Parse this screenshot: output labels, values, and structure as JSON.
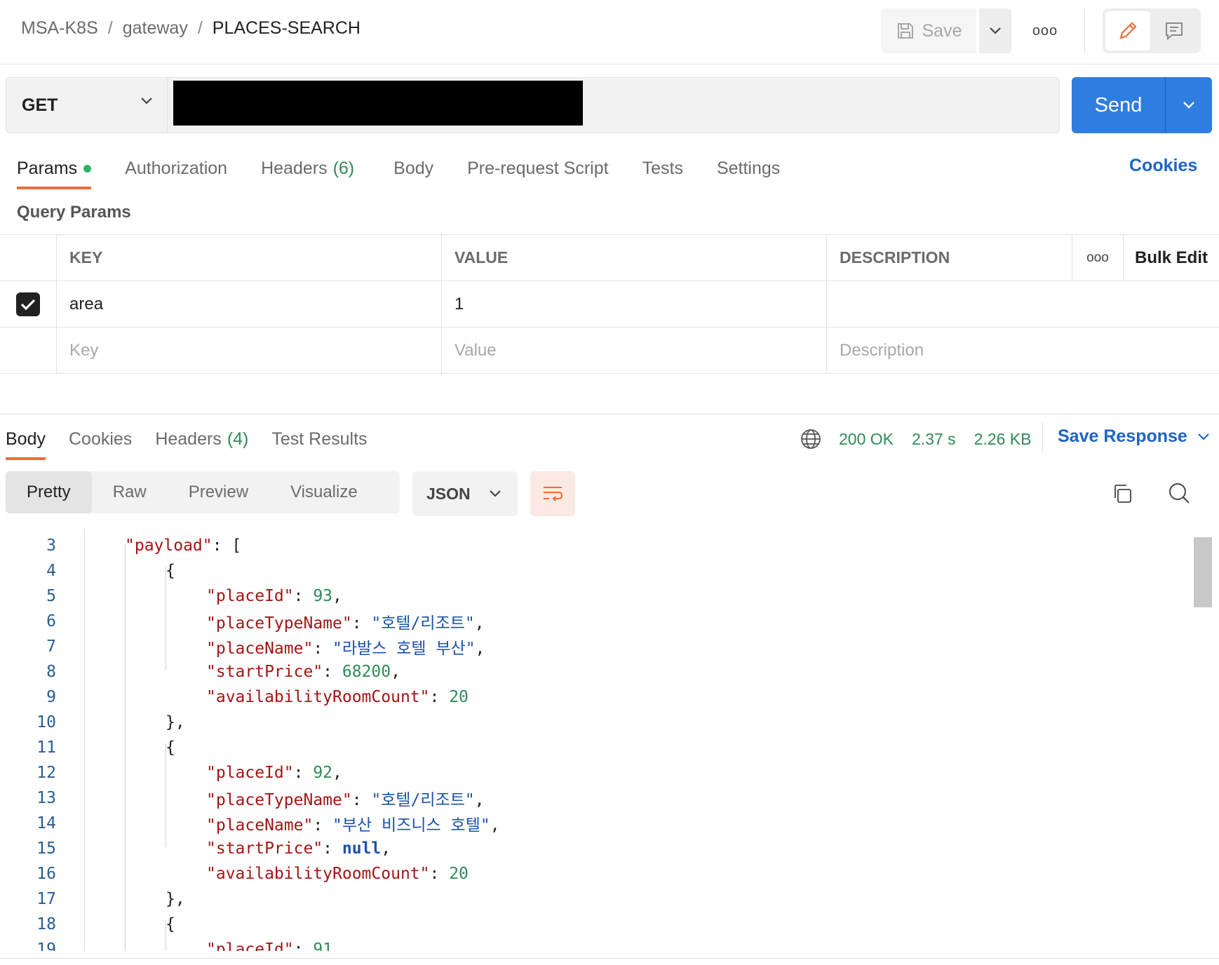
{
  "breadcrumb": {
    "collection": "MSA-K8S",
    "folder": "gateway",
    "request": "PLACES-SEARCH",
    "separator": "/"
  },
  "toolbar": {
    "save_label": "Save",
    "more_label": "ooo"
  },
  "request": {
    "method": "GET",
    "send_label": "Send"
  },
  "request_tabs": {
    "params": "Params",
    "authorization": "Authorization",
    "headers": "Headers",
    "headers_count": "(6)",
    "body": "Body",
    "prerequest": "Pre-request Script",
    "tests": "Tests",
    "settings": "Settings",
    "cookies": "Cookies"
  },
  "query_params": {
    "title": "Query Params",
    "headers": {
      "key": "KEY",
      "value": "VALUE",
      "description": "DESCRIPTION",
      "more": "ooo",
      "bulk_edit": "Bulk Edit"
    },
    "rows": [
      {
        "checked": true,
        "key": "area",
        "value": "1",
        "description": ""
      }
    ],
    "placeholders": {
      "key": "Key",
      "value": "Value",
      "description": "Description"
    }
  },
  "response_tabs": {
    "body": "Body",
    "cookies": "Cookies",
    "headers": "Headers",
    "headers_count": "(4)",
    "test_results": "Test Results"
  },
  "response_meta": {
    "status": "200 OK",
    "time": "2.37 s",
    "size": "2.26 KB",
    "save_response": "Save Response"
  },
  "format": {
    "modes": [
      "Pretty",
      "Raw",
      "Preview",
      "Visualize"
    ],
    "active": "Pretty",
    "language": "JSON"
  },
  "code_lines": [
    {
      "n": "3",
      "indent": 1,
      "tokens": [
        {
          "t": "k",
          "v": "\"payload\""
        },
        {
          "t": "p",
          "v": ": ["
        }
      ]
    },
    {
      "n": "4",
      "indent": 2,
      "tokens": [
        {
          "t": "p",
          "v": "{"
        }
      ]
    },
    {
      "n": "5",
      "indent": 3,
      "tokens": [
        {
          "t": "k",
          "v": "\"placeId\""
        },
        {
          "t": "p",
          "v": ": "
        },
        {
          "t": "n",
          "v": "93"
        },
        {
          "t": "p",
          "v": ","
        }
      ]
    },
    {
      "n": "6",
      "indent": 3,
      "tokens": [
        {
          "t": "k",
          "v": "\"placeTypeName\""
        },
        {
          "t": "p",
          "v": ": "
        },
        {
          "t": "s",
          "v": "\"호텔/리조트\""
        },
        {
          "t": "p",
          "v": ","
        }
      ]
    },
    {
      "n": "7",
      "indent": 3,
      "tokens": [
        {
          "t": "k",
          "v": "\"placeName\""
        },
        {
          "t": "p",
          "v": ": "
        },
        {
          "t": "s",
          "v": "\"라발스 호텔 부산\""
        },
        {
          "t": "p",
          "v": ","
        }
      ]
    },
    {
      "n": "8",
      "indent": 3,
      "tokens": [
        {
          "t": "k",
          "v": "\"startPrice\""
        },
        {
          "t": "p",
          "v": ": "
        },
        {
          "t": "n",
          "v": "68200"
        },
        {
          "t": "p",
          "v": ","
        }
      ]
    },
    {
      "n": "9",
      "indent": 3,
      "tokens": [
        {
          "t": "k",
          "v": "\"availabilityRoomCount\""
        },
        {
          "t": "p",
          "v": ": "
        },
        {
          "t": "n",
          "v": "20"
        }
      ]
    },
    {
      "n": "10",
      "indent": 2,
      "tokens": [
        {
          "t": "p",
          "v": "},"
        }
      ]
    },
    {
      "n": "11",
      "indent": 2,
      "tokens": [
        {
          "t": "p",
          "v": "{"
        }
      ]
    },
    {
      "n": "12",
      "indent": 3,
      "tokens": [
        {
          "t": "k",
          "v": "\"placeId\""
        },
        {
          "t": "p",
          "v": ": "
        },
        {
          "t": "n",
          "v": "92"
        },
        {
          "t": "p",
          "v": ","
        }
      ]
    },
    {
      "n": "13",
      "indent": 3,
      "tokens": [
        {
          "t": "k",
          "v": "\"placeTypeName\""
        },
        {
          "t": "p",
          "v": ": "
        },
        {
          "t": "s",
          "v": "\"호텔/리조트\""
        },
        {
          "t": "p",
          "v": ","
        }
      ]
    },
    {
      "n": "14",
      "indent": 3,
      "tokens": [
        {
          "t": "k",
          "v": "\"placeName\""
        },
        {
          "t": "p",
          "v": ": "
        },
        {
          "t": "s",
          "v": "\"부산 비즈니스 호텔\""
        },
        {
          "t": "p",
          "v": ","
        }
      ]
    },
    {
      "n": "15",
      "indent": 3,
      "tokens": [
        {
          "t": "k",
          "v": "\"startPrice\""
        },
        {
          "t": "p",
          "v": ": "
        },
        {
          "t": "nl",
          "v": "null"
        },
        {
          "t": "p",
          "v": ","
        }
      ]
    },
    {
      "n": "16",
      "indent": 3,
      "tokens": [
        {
          "t": "k",
          "v": "\"availabilityRoomCount\""
        },
        {
          "t": "p",
          "v": ": "
        },
        {
          "t": "n",
          "v": "20"
        }
      ]
    },
    {
      "n": "17",
      "indent": 2,
      "tokens": [
        {
          "t": "p",
          "v": "},"
        }
      ]
    },
    {
      "n": "18",
      "indent": 2,
      "tokens": [
        {
          "t": "p",
          "v": "{"
        }
      ]
    },
    {
      "n": "19",
      "indent": 3,
      "tokens": [
        {
          "t": "k",
          "v": "\"placeId\""
        },
        {
          "t": "p",
          "v": ": "
        },
        {
          "t": "n",
          "v": "91"
        }
      ]
    }
  ],
  "colors": {
    "accent": "#ef6b3a",
    "send": "#2f7de0",
    "link": "#1d64c6",
    "success": "#2e8b57",
    "json_key": "#a31515",
    "json_string": "#1b52a8"
  },
  "icons": {
    "save": "floppy-disk-icon",
    "edit": "pencil-icon",
    "comment": "comment-icon",
    "globe": "globe-icon",
    "copy": "copy-icon",
    "search": "search-icon",
    "wrap": "wrap-lines-icon"
  }
}
